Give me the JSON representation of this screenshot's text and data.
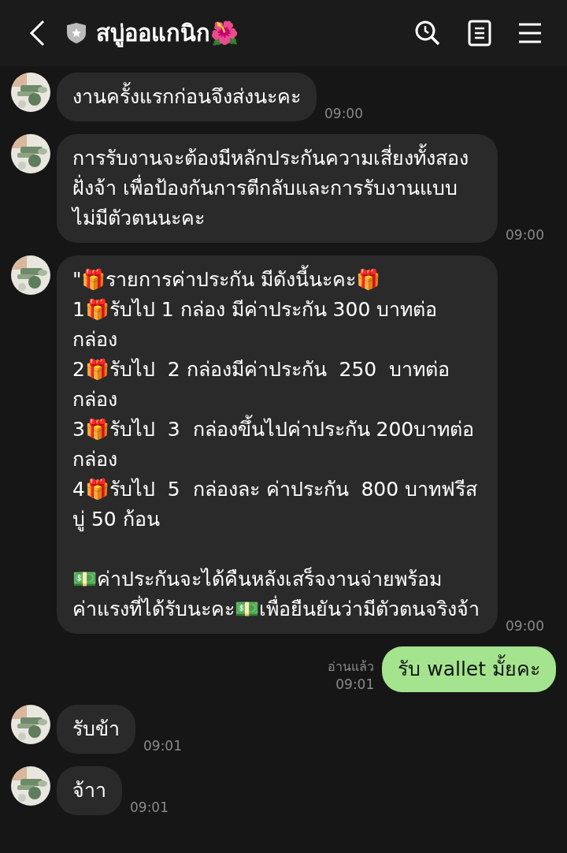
{
  "header": {
    "title": "สบู่ออแกนิก🌺"
  },
  "messages": [
    {
      "kind": "in",
      "text": "งานครั้งแรกก่อนจึงส่งนะคะ",
      "time": "09:00"
    },
    {
      "kind": "in",
      "text": "การรับงานจะต้องมีหลักประกันความเสี่ยงทั้งสองฝั่งจ้า เพื่อป้องกันการตีกลับและการรับงานแบบไม่มีตัวตนนะคะ",
      "time": "09:00"
    },
    {
      "kind": "in",
      "text": "\"🎁รายการค่าประกัน มีดังนี้นะคะ🎁\n1🎁รับไป 1 กล่อง มีค่าประกัน 300 บาทต่อกล่อง\n2🎁รับไป  2 กล่องมีค่าประกัน  250  บาทต่อกล่อง\n3🎁รับไป  3  กล่องขึ้นไปค่าประกัน 200บาทต่อกล่อง\n4🎁รับไป  5  กล่องละ ค่าประกัน  800 บาทฟรีสบู่ 50 ก้อน\n\n💵ค่าประกันจะได้คืนหลังเสร็จงานจ่ายพร้อมค่าแรงที่ได้รับนะคะ💵เพื่อยืนยันว่ามีตัวตนจริงจ้า",
      "time": "09:00"
    },
    {
      "kind": "out",
      "text": "รับ wallet มั้ยคะ",
      "read": "อ่านแล้ว",
      "time": "09:01"
    },
    {
      "kind": "in",
      "text": "รับข้า",
      "time": "09:01"
    },
    {
      "kind": "in",
      "text": "จ้าา",
      "time": "09:01"
    }
  ]
}
